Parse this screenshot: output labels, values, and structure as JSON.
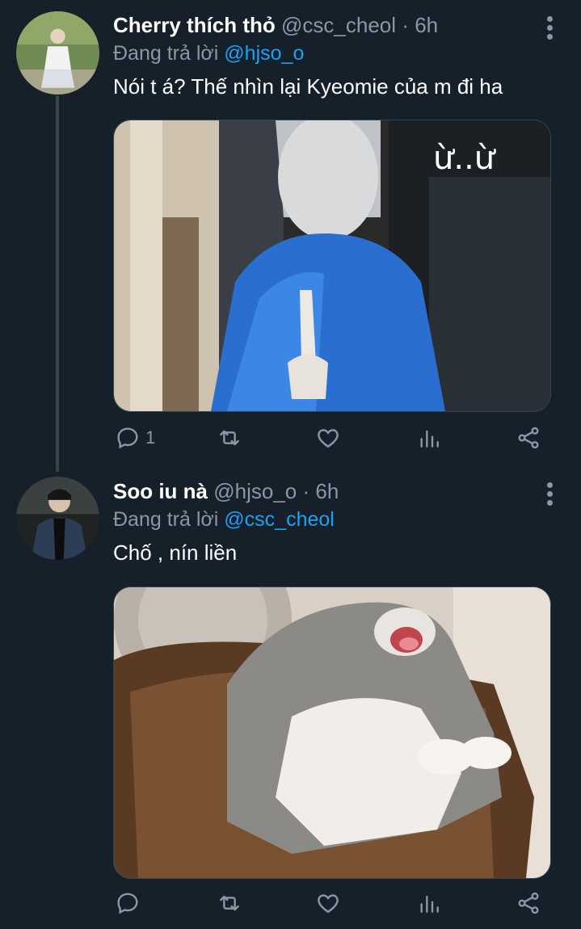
{
  "tweets": [
    {
      "name": "Cherry thích thỏ",
      "handle": "@csc_cheol",
      "dot": "·",
      "time": "6h",
      "reply_prefix": "Đang trả lời",
      "reply_to": "@hjso_o",
      "text": "Nói t á? Thế nhìn lại Kyeomie của m đi ha",
      "media_caption": "ừ..ừ",
      "reply_count": "1"
    },
    {
      "name": "Soo iu nà",
      "handle": "@hjso_o",
      "dot": "·",
      "time": "6h",
      "reply_prefix": "Đang trả lời",
      "reply_to": "@csc_cheol",
      "text": "Chố , nín liền",
      "reply_count": ""
    }
  ],
  "icons": [
    "more-vertical-icon",
    "reply-icon",
    "retweet-icon",
    "like-icon",
    "analytics-icon",
    "share-icon"
  ],
  "colors": {
    "background": "#15202b",
    "secondary_text": "#8899a6",
    "accent": "#1da1f2",
    "divider": "#38444d"
  }
}
